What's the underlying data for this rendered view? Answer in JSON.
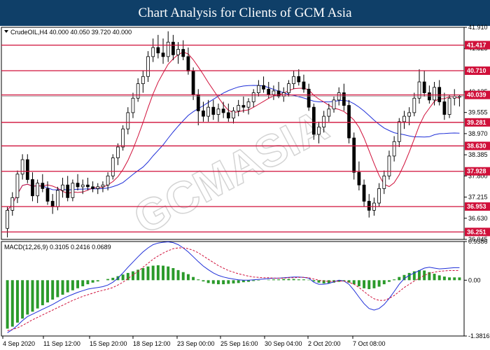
{
  "title": "Chart Analysis for Clients of GCM Asia",
  "chart_data": [
    {
      "type": "candlestick",
      "header": "CrudeOIL,H4  40.000 40.050 39.720 40.000",
      "symbol": "CrudeOIL,H4",
      "ohlc_last": {
        "open": 40.0,
        "high": 40.05,
        "low": 39.72,
        "close": 40.0
      },
      "ylim": [
        36.045,
        41.91
      ],
      "y_ticks": [
        "41.910",
        "41.325",
        "40.125",
        "39.555",
        "38.970",
        "38.385",
        "37.800",
        "37.215",
        "36.630",
        "36.045"
      ],
      "x_ticks": [
        "4 Sep 2020",
        "11 Sep 12:00",
        "15 Sep 20:00",
        "18 Sep 12:00",
        "23 Sep 00:00",
        "25 Sep 16:00",
        "30 Sep 04:00",
        "2 Oct 20:00",
        "7 Oct 08:00"
      ],
      "levels": [
        "41.417",
        "40.710",
        "40.039",
        "39.281",
        "38.630",
        "37.928",
        "36.953",
        "36.251"
      ],
      "current_price": "40.000",
      "colors": {
        "level": "#d0103a",
        "ma_fast": "#d0103a",
        "ma_slow": "#1f2fd8",
        "candle": "#000000",
        "up_fill": "#ffffff"
      },
      "candles": [
        [
          36.35,
          36.95,
          36.1,
          36.85
        ],
        [
          36.85,
          37.35,
          36.7,
          37.2
        ],
        [
          37.2,
          37.95,
          37.05,
          37.85
        ],
        [
          37.85,
          38.4,
          37.7,
          38.25
        ],
        [
          38.25,
          38.4,
          37.6,
          37.7
        ],
        [
          37.7,
          37.9,
          37.1,
          37.25
        ],
        [
          37.25,
          37.7,
          37.05,
          37.6
        ],
        [
          37.6,
          37.85,
          37.35,
          37.45
        ],
        [
          37.45,
          37.65,
          37.0,
          37.1
        ],
        [
          37.1,
          37.3,
          36.75,
          36.95
        ],
        [
          36.95,
          37.5,
          36.85,
          37.4
        ],
        [
          37.4,
          37.75,
          37.2,
          37.55
        ],
        [
          37.55,
          37.8,
          37.1,
          37.2
        ],
        [
          37.2,
          37.7,
          37.1,
          37.6
        ],
        [
          37.6,
          37.85,
          37.4,
          37.5
        ],
        [
          37.5,
          37.7,
          37.3,
          37.55
        ],
        [
          37.55,
          37.75,
          37.4,
          37.5
        ],
        [
          37.5,
          37.65,
          37.35,
          37.45
        ],
        [
          37.45,
          37.6,
          37.3,
          37.5
        ],
        [
          37.5,
          37.65,
          37.35,
          37.55
        ],
        [
          37.55,
          37.9,
          37.4,
          37.8
        ],
        [
          37.8,
          38.4,
          37.7,
          38.3
        ],
        [
          38.3,
          38.7,
          38.1,
          38.6
        ],
        [
          38.6,
          39.2,
          38.5,
          39.1
        ],
        [
          39.1,
          39.7,
          38.95,
          39.55
        ],
        [
          39.55,
          40.1,
          39.4,
          39.95
        ],
        [
          39.95,
          40.5,
          39.85,
          40.35
        ],
        [
          40.35,
          40.7,
          40.1,
          40.55
        ],
        [
          40.55,
          41.25,
          40.4,
          41.1
        ],
        [
          41.1,
          41.6,
          40.95,
          41.35
        ],
        [
          41.35,
          41.7,
          41.05,
          41.2
        ],
        [
          41.2,
          41.6,
          40.9,
          41.1
        ],
        [
          41.1,
          41.8,
          40.95,
          41.5
        ],
        [
          41.5,
          41.7,
          41.0,
          41.15
        ],
        [
          41.15,
          41.5,
          40.9,
          41.3
        ],
        [
          41.3,
          41.55,
          41.0,
          41.1
        ],
        [
          41.1,
          41.35,
          40.6,
          40.7
        ],
        [
          40.7,
          40.8,
          39.9,
          40.05
        ],
        [
          40.05,
          40.2,
          39.2,
          39.6
        ],
        [
          39.6,
          39.85,
          39.3,
          39.45
        ],
        [
          39.45,
          39.9,
          39.3,
          39.7
        ],
        [
          39.7,
          39.9,
          39.35,
          39.5
        ],
        [
          39.5,
          39.8,
          39.3,
          39.65
        ],
        [
          39.65,
          39.85,
          39.4,
          39.55
        ],
        [
          39.55,
          39.8,
          39.3,
          39.4
        ],
        [
          39.4,
          39.7,
          39.25,
          39.6
        ],
        [
          39.6,
          39.9,
          39.45,
          39.75
        ],
        [
          39.75,
          40.0,
          39.55,
          39.7
        ],
        [
          39.7,
          39.95,
          39.5,
          39.85
        ],
        [
          39.85,
          40.2,
          39.7,
          40.1
        ],
        [
          40.1,
          40.45,
          40.0,
          40.3
        ],
        [
          40.3,
          40.55,
          40.1,
          40.2
        ],
        [
          40.2,
          40.4,
          39.95,
          40.05
        ],
        [
          40.05,
          40.3,
          39.9,
          40.15
        ],
        [
          40.15,
          40.4,
          39.95,
          40.0
        ],
        [
          40.0,
          40.25,
          39.85,
          40.1
        ],
        [
          40.1,
          40.45,
          40.0,
          40.35
        ],
        [
          40.35,
          40.7,
          40.2,
          40.55
        ],
        [
          40.55,
          40.75,
          40.3,
          40.4
        ],
        [
          40.4,
          40.6,
          40.1,
          40.2
        ],
        [
          40.2,
          40.35,
          39.6,
          39.7
        ],
        [
          39.7,
          39.8,
          38.8,
          38.95
        ],
        [
          38.95,
          39.3,
          38.7,
          39.15
        ],
        [
          39.15,
          39.6,
          39.0,
          39.45
        ],
        [
          39.45,
          39.8,
          39.3,
          39.65
        ],
        [
          39.65,
          40.0,
          39.55,
          39.9
        ],
        [
          39.9,
          40.25,
          39.75,
          40.1
        ],
        [
          40.1,
          40.35,
          39.6,
          39.75
        ],
        [
          39.75,
          39.9,
          38.7,
          38.85
        ],
        [
          38.85,
          39.0,
          37.7,
          37.9
        ],
        [
          37.9,
          38.2,
          37.4,
          37.55
        ],
        [
          37.55,
          37.7,
          36.95,
          37.1
        ],
        [
          37.1,
          37.3,
          36.65,
          36.85
        ],
        [
          36.85,
          37.2,
          36.7,
          37.05
        ],
        [
          37.05,
          37.6,
          36.95,
          37.45
        ],
        [
          37.45,
          37.95,
          37.3,
          37.8
        ],
        [
          37.8,
          38.5,
          37.7,
          38.35
        ],
        [
          38.35,
          38.9,
          38.2,
          38.75
        ],
        [
          38.75,
          39.4,
          38.6,
          39.3
        ],
        [
          39.3,
          39.6,
          39.1,
          39.45
        ],
        [
          39.45,
          39.7,
          39.2,
          39.55
        ],
        [
          39.55,
          40.1,
          39.45,
          39.95
        ],
        [
          39.95,
          40.75,
          39.8,
          40.4
        ],
        [
          40.4,
          40.7,
          40.0,
          40.1
        ],
        [
          40.1,
          40.3,
          39.8,
          39.9
        ],
        [
          39.9,
          40.4,
          39.75,
          40.25
        ],
        [
          40.25,
          40.45,
          39.75,
          39.85
        ],
        [
          39.85,
          40.1,
          39.35,
          39.5
        ],
        [
          39.5,
          40.05,
          39.4,
          39.95
        ],
        [
          39.95,
          40.2,
          39.75,
          40.0
        ],
        [
          40.0,
          40.05,
          39.72,
          40.0
        ]
      ]
    },
    {
      "type": "macd",
      "header": "MACD(12,26,9) 0.3105 0.2416 0.0689",
      "y_ticks": [
        "0.9586",
        "0.00",
        "-1.3816"
      ],
      "ylim": [
        -1.3816,
        0.9586
      ],
      "histogram": [
        -1.2,
        -1.15,
        -1.05,
        -0.95,
        -0.85,
        -0.78,
        -0.7,
        -0.62,
        -0.55,
        -0.48,
        -0.42,
        -0.36,
        -0.3,
        -0.25,
        -0.2,
        -0.15,
        -0.1,
        -0.06,
        -0.03,
        0.0,
        0.03,
        0.06,
        0.1,
        0.14,
        0.18,
        0.22,
        0.26,
        0.3,
        0.34,
        0.36,
        0.37,
        0.36,
        0.34,
        0.3,
        0.25,
        0.2,
        0.15,
        0.08,
        0.02,
        -0.03,
        -0.07,
        -0.09,
        -0.1,
        -0.1,
        -0.09,
        -0.08,
        -0.07,
        -0.05,
        -0.04,
        -0.02,
        -0.01,
        0.0,
        0.01,
        0.02,
        0.02,
        0.03,
        0.03,
        0.03,
        0.02,
        0.02,
        0.01,
        -0.03,
        -0.06,
        -0.08,
        -0.08,
        -0.06,
        -0.04,
        -0.03,
        -0.06,
        -0.1,
        -0.15,
        -0.2,
        -0.22,
        -0.2,
        -0.16,
        -0.1,
        -0.04,
        0.02,
        0.08,
        0.13,
        0.18,
        0.22,
        0.25,
        0.24,
        0.2,
        0.16,
        0.12,
        0.09,
        0.07,
        0.07,
        0.069
      ],
      "macd": [
        -1.3,
        -1.22,
        -1.12,
        -1.0,
        -0.9,
        -0.84,
        -0.78,
        -0.72,
        -0.66,
        -0.6,
        -0.53,
        -0.46,
        -0.4,
        -0.35,
        -0.3,
        -0.26,
        -0.22,
        -0.2,
        -0.18,
        -0.16,
        -0.12,
        -0.05,
        0.05,
        0.18,
        0.32,
        0.45,
        0.58,
        0.7,
        0.8,
        0.88,
        0.92,
        0.94,
        0.95,
        0.93,
        0.88,
        0.8,
        0.7,
        0.58,
        0.46,
        0.35,
        0.26,
        0.18,
        0.12,
        0.08,
        0.05,
        0.03,
        0.01,
        0.0,
        0.0,
        0.01,
        0.02,
        0.03,
        0.04,
        0.05,
        0.05,
        0.06,
        0.07,
        0.08,
        0.08,
        0.07,
        0.05,
        -0.05,
        -0.1,
        -0.1,
        -0.08,
        -0.04,
        0.0,
        -0.02,
        -0.1,
        -0.25,
        -0.42,
        -0.58,
        -0.7,
        -0.74,
        -0.7,
        -0.6,
        -0.45,
        -0.28,
        -0.1,
        0.04,
        0.12,
        0.18,
        0.24,
        0.3,
        0.32,
        0.3,
        0.28,
        0.29,
        0.3,
        0.31,
        0.3105
      ],
      "signal": [
        -1.25,
        -1.22,
        -1.18,
        -1.12,
        -1.05,
        -0.98,
        -0.92,
        -0.86,
        -0.8,
        -0.74,
        -0.68,
        -0.62,
        -0.56,
        -0.5,
        -0.45,
        -0.4,
        -0.36,
        -0.32,
        -0.28,
        -0.25,
        -0.22,
        -0.18,
        -0.12,
        -0.05,
        0.04,
        0.13,
        0.22,
        0.32,
        0.42,
        0.52,
        0.6,
        0.67,
        0.73,
        0.78,
        0.8,
        0.8,
        0.78,
        0.74,
        0.68,
        0.6,
        0.52,
        0.44,
        0.36,
        0.3,
        0.24,
        0.2,
        0.16,
        0.13,
        0.1,
        0.08,
        0.07,
        0.06,
        0.06,
        0.05,
        0.05,
        0.05,
        0.06,
        0.06,
        0.07,
        0.07,
        0.06,
        0.03,
        0.0,
        -0.02,
        -0.03,
        -0.03,
        -0.02,
        -0.02,
        -0.05,
        -0.1,
        -0.18,
        -0.28,
        -0.38,
        -0.46,
        -0.5,
        -0.5,
        -0.45,
        -0.38,
        -0.28,
        -0.18,
        -0.1,
        -0.02,
        0.05,
        0.12,
        0.17,
        0.2,
        0.22,
        0.23,
        0.24,
        0.24,
        0.2416
      ]
    }
  ]
}
